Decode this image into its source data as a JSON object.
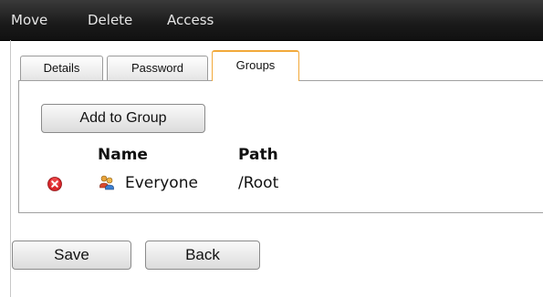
{
  "toolbar": {
    "move_label": "Move",
    "delete_label": "Delete",
    "access_label": "Access"
  },
  "tabs": [
    {
      "label": "Details",
      "active": false
    },
    {
      "label": "Password",
      "active": false
    },
    {
      "label": "Groups",
      "active": true
    }
  ],
  "groups_panel": {
    "add_button_label": "Add to Group",
    "columns": [
      "Name",
      "Path"
    ],
    "rows": [
      {
        "name": "Everyone",
        "path": "/Root",
        "icon": "group-users-icon",
        "remove_icon": "remove-icon"
      }
    ]
  },
  "actions": {
    "save_label": "Save",
    "back_label": "Back"
  },
  "colors": {
    "toolbar_bg": "#1a1a1a",
    "active_tab_accent": "#f2a93a",
    "remove_icon": "#d9262b"
  }
}
